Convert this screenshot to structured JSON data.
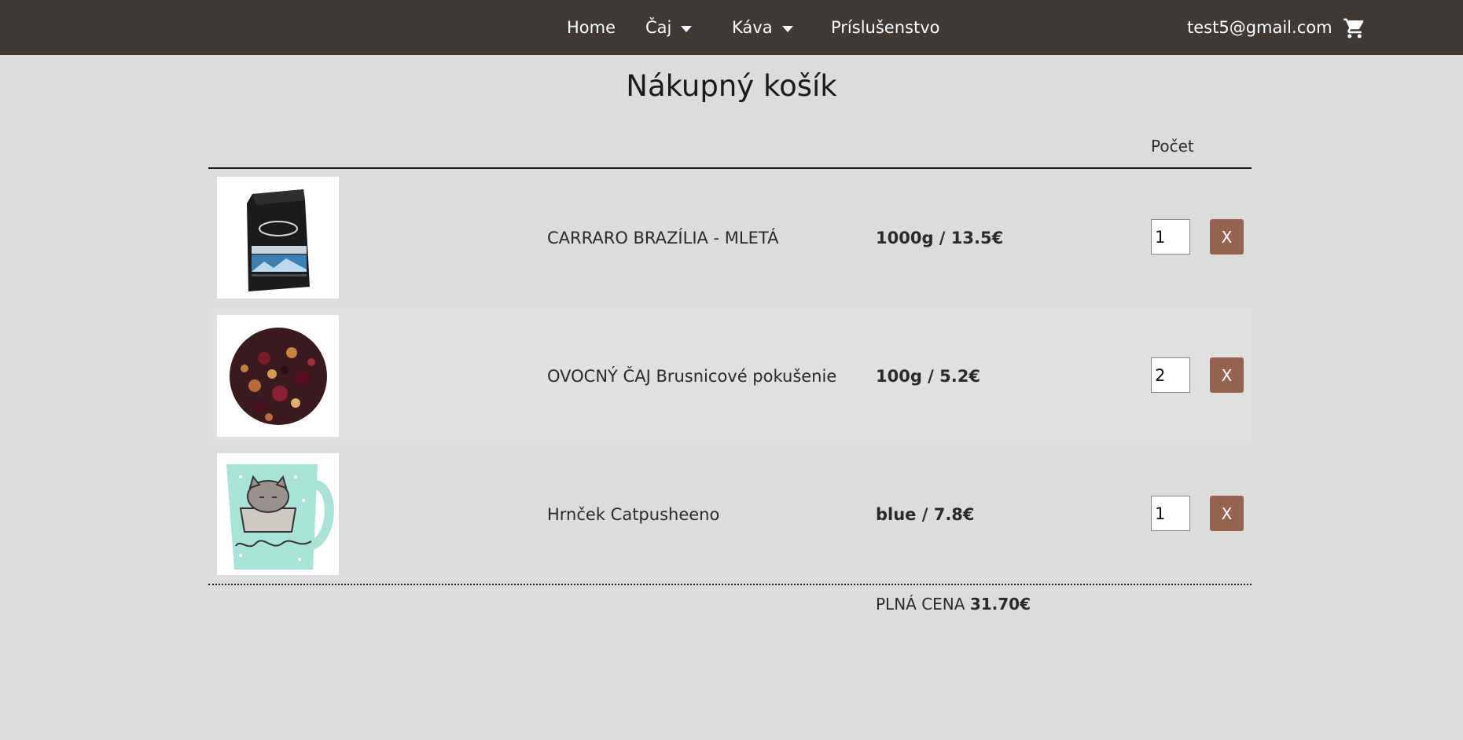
{
  "nav": {
    "home": "Home",
    "tea": "Čaj",
    "coffee": "Káva",
    "accessories": "Príslušenstvo",
    "user_email": "test5@gmail.com",
    "cart_icon": "shopping-cart-icon"
  },
  "page": {
    "title": "Nákupný košík"
  },
  "table": {
    "count_header": "Počet"
  },
  "items": [
    {
      "name": "CARRARO BRAZÍLIA - MLETÁ",
      "price": "1000g / 13.5€",
      "quantity": "1",
      "remove_label": "X",
      "image": "coffee-bag-image"
    },
    {
      "name": "OVOCNÝ ČAJ Brusnicové pokušenie",
      "price": "100g / 5.2€",
      "quantity": "2",
      "remove_label": "X",
      "image": "fruit-tea-image"
    },
    {
      "name": "Hrnček Catpusheeno",
      "price": "blue / 7.8€",
      "quantity": "1",
      "remove_label": "X",
      "image": "mug-image"
    }
  ],
  "total": {
    "label": "PLNÁ CENA",
    "value": "31.70€"
  },
  "colors": {
    "navbar": "#3c3937",
    "background": "#dcdcdb",
    "remove_button": "#956450"
  }
}
